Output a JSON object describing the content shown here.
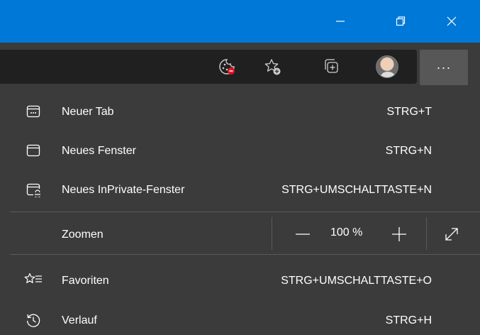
{
  "window": {
    "titlebar_color": "#0078d7",
    "controls": [
      "minimize-icon",
      "restore-icon",
      "close-icon"
    ]
  },
  "toolbar": {
    "icons": [
      "cookie-blocked-icon",
      "add-favorite-icon",
      "collections-icon",
      "profile-avatar",
      "more-icon"
    ],
    "more_label": "···"
  },
  "menu": {
    "items": [
      {
        "label": "Neuer Tab",
        "shortcut": "STRG+T",
        "icon": "new-tab-icon"
      },
      {
        "label": "Neues Fenster",
        "shortcut": "STRG+N",
        "icon": "new-window-icon"
      },
      {
        "label": "Neues InPrivate-Fenster",
        "shortcut": "STRG+UMSCHALTTASTE+N",
        "icon": "inprivate-window-icon"
      }
    ],
    "zoom": {
      "label": "Zoomen",
      "value": "100 %",
      "controls": [
        "zoom-out-icon",
        "zoom-in-icon",
        "fullscreen-icon"
      ]
    },
    "items2": [
      {
        "label": "Favoriten",
        "shortcut": "STRG+UMSCHALTTASTE+O",
        "icon": "favorites-icon"
      },
      {
        "label": "Verlauf",
        "shortcut": "STRG+H",
        "icon": "history-icon"
      }
    ]
  }
}
